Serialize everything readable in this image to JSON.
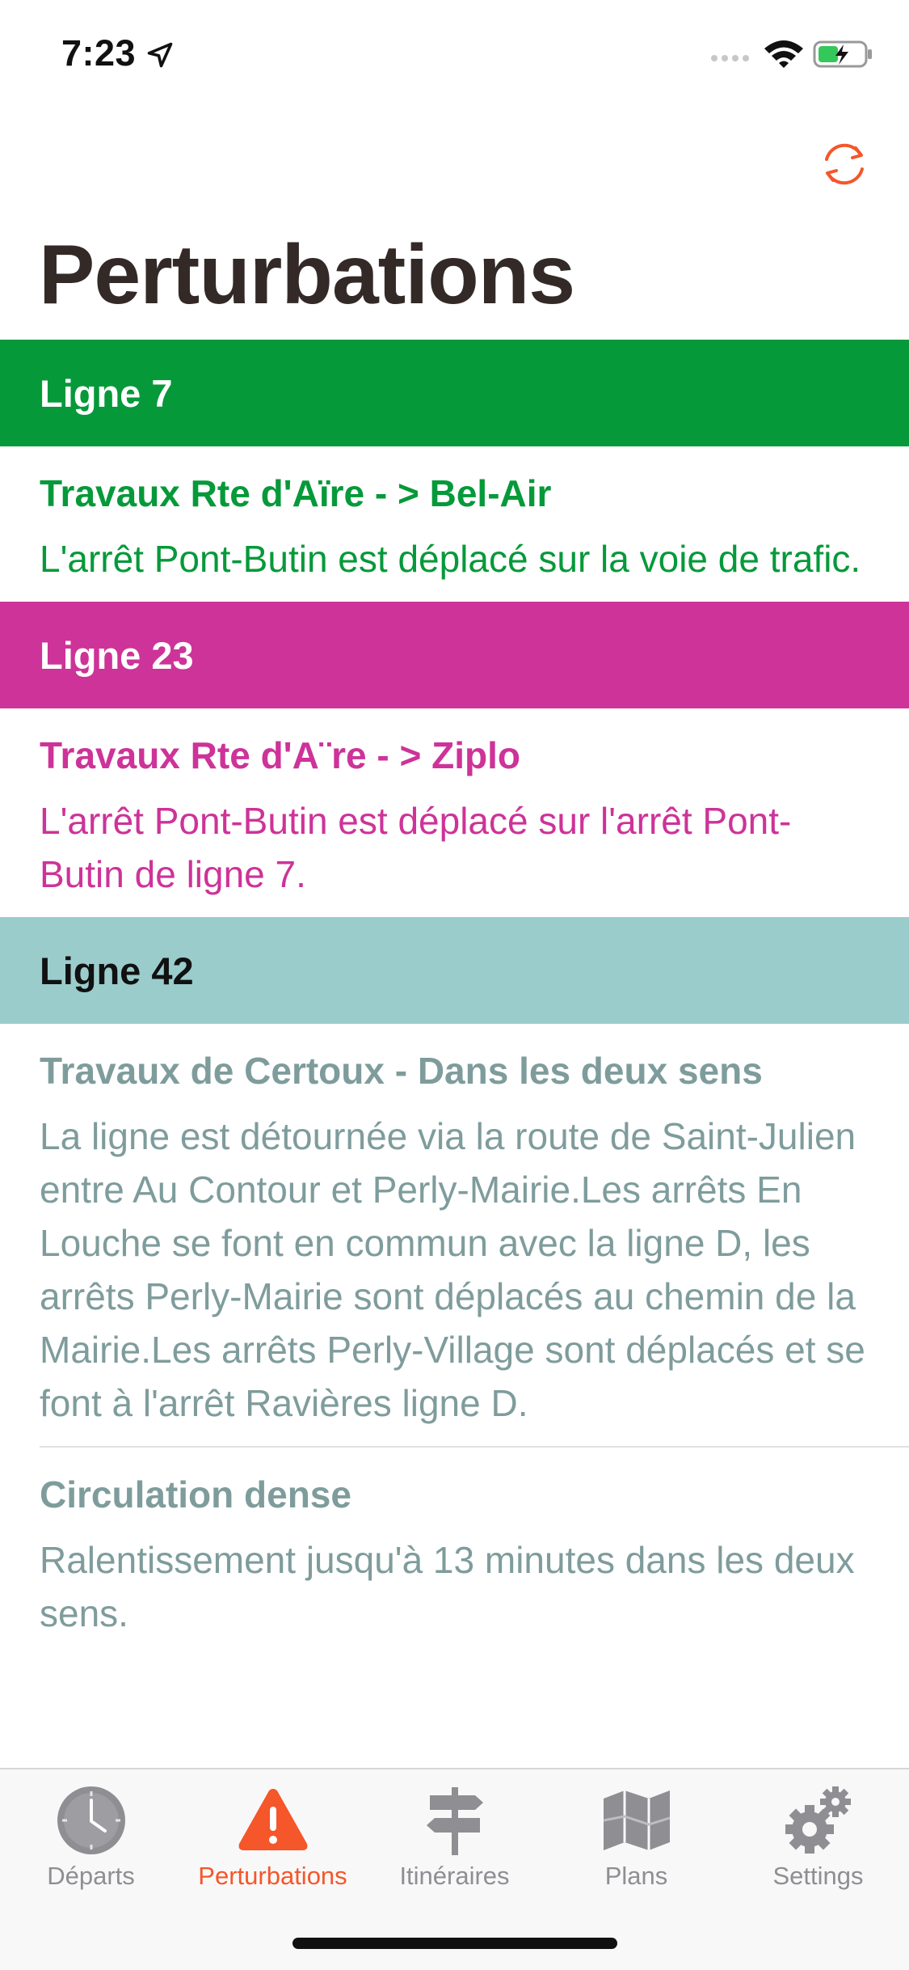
{
  "status": {
    "time": "7:23"
  },
  "colors": {
    "accent": "#f5562a",
    "ligne7": "#06993a",
    "ligne23": "#cd3398",
    "ligne42_header": "#9acccc",
    "ligne42_text": "#7f9c9c"
  },
  "nav": {
    "title": "Perturbations",
    "refresh_icon": "refresh-icon"
  },
  "sections": [
    {
      "header": "Ligne 7",
      "items": [
        {
          "title": "Travaux Rte d'Aïre - > Bel-Air",
          "body": "L'arrêt Pont-Butin est déplacé sur la voie de trafic."
        }
      ]
    },
    {
      "header": "Ligne 23",
      "items": [
        {
          "title": "Travaux Rte d'A¨re - > Ziplo",
          "body": "L'arrêt Pont-Butin est déplacé sur l'arrêt Pont-Butin de ligne 7."
        }
      ]
    },
    {
      "header": "Ligne 42",
      "items": [
        {
          "title": "Travaux de Certoux - Dans les deux sens",
          "body": "La ligne est détournée via la route de Saint-Julien entre Au Contour et Perly-Mairie.Les arrêts En Louche se font en commun avec la ligne D, les arrêts Perly-Mairie sont déplacés au chemin de la Mairie.Les arrêts Perly-Village sont déplacés et se font à l'arrêt Ravières ligne D."
        },
        {
          "title": "Circulation dense",
          "body": "Ralentissement jusqu'à 13 minutes dans les deux sens."
        }
      ]
    }
  ],
  "tabs": [
    {
      "label": "Départs",
      "icon": "clock-icon",
      "active": false
    },
    {
      "label": "Perturbations",
      "icon": "warning-icon",
      "active": true
    },
    {
      "label": "Itinéraires",
      "icon": "signpost-icon",
      "active": false
    },
    {
      "label": "Plans",
      "icon": "map-icon",
      "active": false
    },
    {
      "label": "Settings",
      "icon": "gear-icon",
      "active": false
    }
  ]
}
